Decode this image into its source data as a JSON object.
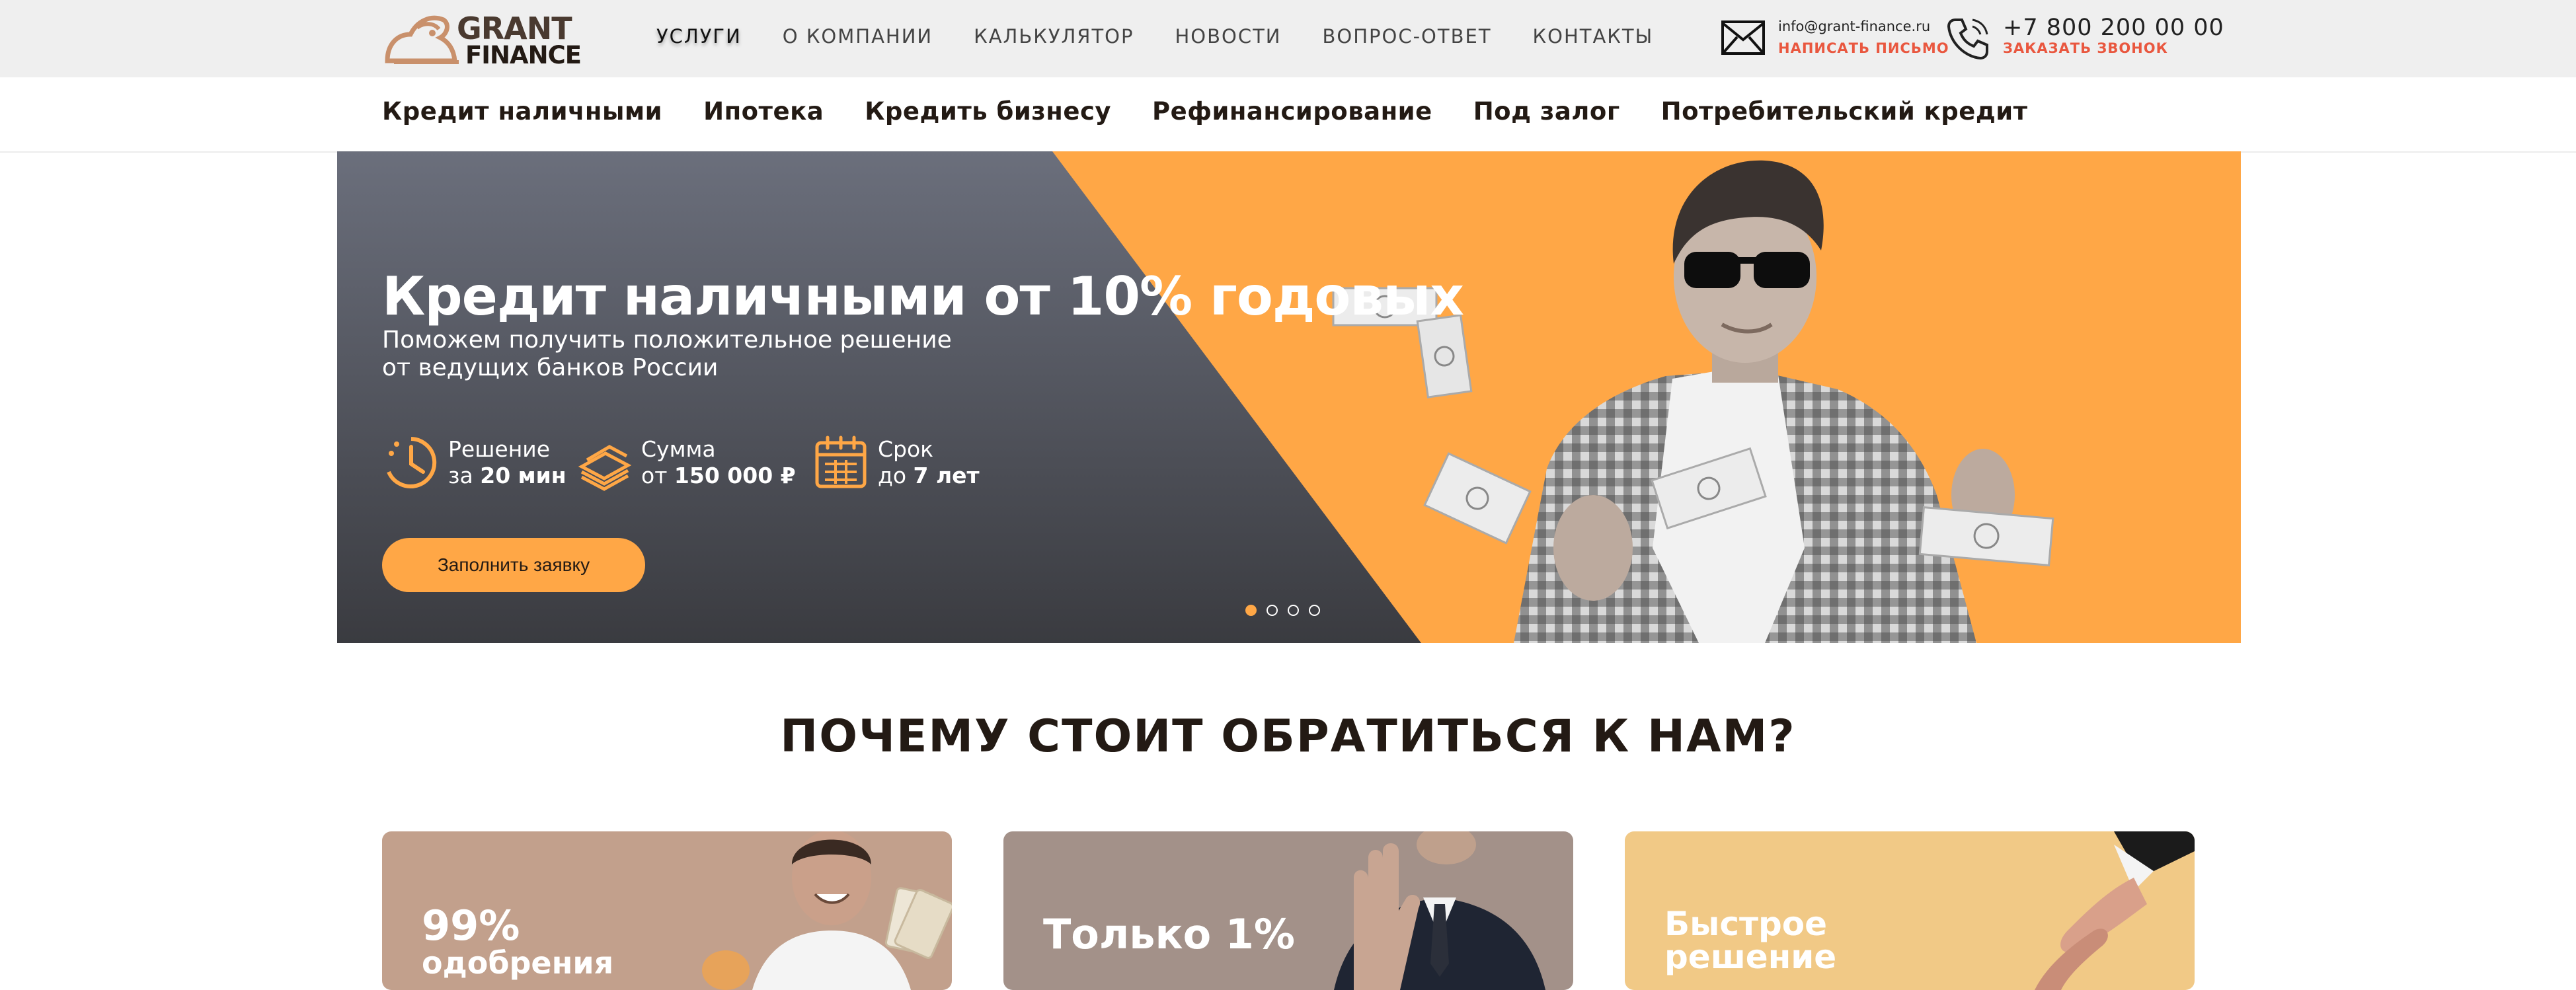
{
  "header": {
    "logo": {
      "line1": "GRANT",
      "line2": "FINANCE"
    },
    "nav": [
      {
        "label": "УСЛУГИ"
      },
      {
        "label": "О КОМПАНИИ"
      },
      {
        "label": "КАЛЬКУЛЯТОР"
      },
      {
        "label": "НОВОСТИ"
      },
      {
        "label": "ВОПРОС-ОТВЕТ"
      },
      {
        "label": "КОНТАКТЫ"
      }
    ],
    "active_nav": "УСЛУГИ",
    "email": "info@grant-finance.ru",
    "email_cta": "НАПИСАТЬ ПИСЬМО",
    "phone": "+7 800 200 00 00",
    "phone_cta": "ЗАКАЗАТЬ ЗВОНОК"
  },
  "subnav": [
    {
      "label": "Кредит наличными"
    },
    {
      "label": "Ипотека"
    },
    {
      "label": "Кредить бизнесу"
    },
    {
      "label": "Рефинансирование"
    },
    {
      "label": "Под залог"
    },
    {
      "label": "Потребительский кредит"
    }
  ],
  "hero": {
    "title": "Кредит наличными от 10% годовых",
    "subtitle": "Поможем получить положительное решение от ведущих банков России",
    "features": [
      {
        "icon": "clock-icon",
        "line1": "Решение",
        "line2_prefix": "за ",
        "line2_bold": "20 мин"
      },
      {
        "icon": "money-stack-icon",
        "line1": "Сумма",
        "line2_prefix": "от ",
        "line2_bold": "150 000 ₽"
      },
      {
        "icon": "calendar-icon",
        "line1": "Срок",
        "line2_prefix": "до ",
        "line2_bold": "7 лет"
      }
    ],
    "cta": "Заполнить заявку",
    "slides_total": 4,
    "slide_active": 1
  },
  "why": {
    "title": "ПОЧЕМУ СТОИТ ОБРАТИТЬСЯ К НАМ?",
    "cards": [
      {
        "title": "99%",
        "subtitle": "одобрения"
      },
      {
        "title": "Только 1%",
        "subtitle": ""
      },
      {
        "title": "Быстрое",
        "subtitle": "решение"
      }
    ]
  },
  "colors": {
    "accent": "#ffa746",
    "accent_red": "#e9573f",
    "dark": "#231a14",
    "hero_dark_top": "#6b6f7c",
    "hero_dark_bottom": "#3a3b40"
  }
}
